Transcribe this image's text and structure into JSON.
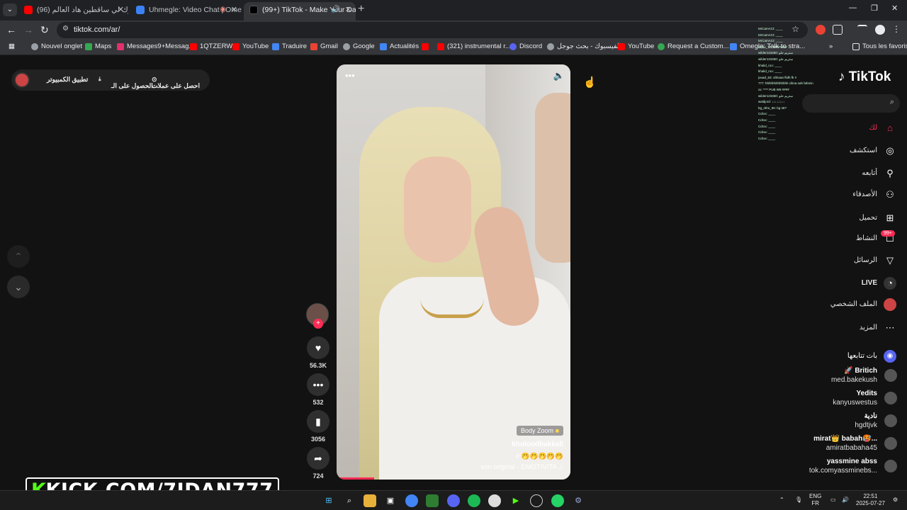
{
  "tabs": [
    {
      "title": "(96) ذوك لي ساقطين هاد العالم",
      "favicon_color": "#ff0000"
    },
    {
      "title": "Uhmegle: Video Chat | Ome",
      "favicon_color": "#3b82f6"
    },
    {
      "title": "(99+) TikTok - Make Your Da",
      "favicon_color": "#000000"
    }
  ],
  "toolbar": {
    "url": "tiktok.com/ar/"
  },
  "bookmarks": [
    {
      "label": "Nouvel onglet",
      "color": "#9aa0a6"
    },
    {
      "label": "Maps",
      "color": "#34a853"
    },
    {
      "label": "Messages9+Messag...",
      "color": "#e1306c"
    },
    {
      "label": "1QTZERW",
      "color": "#ff0000"
    },
    {
      "label": "YouTube",
      "color": "#ff0000"
    },
    {
      "label": "Traduire",
      "color": "#4285f4"
    },
    {
      "label": "Gmail",
      "color": "#ea4335"
    },
    {
      "label": "Google",
      "color": "#9aa0a6"
    },
    {
      "label": "Actualités",
      "color": "#4285f4"
    },
    {
      "label": "(321) instrumental r...",
      "color": "#ff0000"
    },
    {
      "label": "Discord",
      "color": "#5865f2"
    },
    {
      "label": "الفيسبوك - بحث جوجل",
      "color": "#9aa0a6"
    },
    {
      "label": "YouTube",
      "color": "#ff0000"
    },
    {
      "label": "Request a Custom...",
      "color": "#34a853"
    },
    {
      "label": "Omegle: Talk to stra...",
      "color": "#4285f4"
    },
    {
      "label": "Tous les favoris",
      "color": "#9aa0a6"
    }
  ],
  "topbar": {
    "coins": "احصل على عملات",
    "get_app": "الحصول على الـ...",
    "desktop_app": "تطبيق الكمبيوتر"
  },
  "video": {
    "body_zoom": "Body Zoom",
    "author": "kholoodbakkali",
    "caption": "# 🤭🤭🤭🤭🤭",
    "sound": "son original - EMOTIVITA ♫",
    "progress_percent": 16
  },
  "actions": {
    "likes": "56.3K",
    "comments": "532",
    "saves": "3056",
    "shares": "724"
  },
  "brand": {
    "logo": "TikTok",
    "accent": "#fe2c55"
  },
  "nav": [
    {
      "label": "لك",
      "icon": "home-icon",
      "active": true
    },
    {
      "label": "استكشف",
      "icon": "compass-icon"
    },
    {
      "label": "أتابعه",
      "icon": "following-icon"
    },
    {
      "label": "الأصدقاء",
      "icon": "friends-icon"
    },
    {
      "label": "تحميل",
      "icon": "upload-icon"
    },
    {
      "label": "النشاط",
      "icon": "activity-icon"
    },
    {
      "label": "الرسائل",
      "icon": "messages-icon"
    },
    {
      "label": "LIVE",
      "icon": "live-icon"
    },
    {
      "label": "الملف الشخصي",
      "icon": "profile-icon"
    },
    {
      "label": "المزيد",
      "icon": "more-icon"
    }
  ],
  "activity_badge": "99+",
  "following": {
    "title": "بات تتابعها",
    "accounts": [
      {
        "name": "🚀 Britich",
        "handle": "med.bakekush"
      },
      {
        "name": "Yedits",
        "handle": "kanyuswestus"
      },
      {
        "name": "نادية",
        "handle": "hgdtjvk"
      },
      {
        "name": "mirat👑 babah🥵...",
        "handle": "amiratbabaha45"
      },
      {
        "name": "yassmine abss",
        "handle": "tok.comyassminebs..."
      }
    ]
  },
  "chat_lines": [
    "MrCamACt: ____",
    "MrCamACt: ____",
    "MrCamACt: ____",
    "kiddo_77: ########",
    "wilder123450: ستريم حلو",
    "wilder123450: ستريم حلو",
    "khalid_roo: ____",
    "khalid_roo: ____",
    "jouad_63: ohhoan flolh fk !!",
    "777: hhhhhhhhhhhhh clima nah fahmin",
    "xx: **** PUB W9 ####",
    "wilder123450: ستريم حلو",
    "waldjord: ↓↓↓↓↓↓↓↓",
    "bg_ntho_96: bg ntt?",
    "Cdrxx: ____",
    "Cdrxx: ____",
    "Cdrxx: ____",
    "Cdrxx: ____",
    "Cdrxx: ____"
  ],
  "watermark": {
    "prefix": "K",
    "text": "KICK.COM/7IDAN777",
    "accent": "#53fc18"
  },
  "taskbar": {
    "lang_top": "ENG",
    "lang_bottom": "FR",
    "time": "22:51",
    "date": "2025-07-27"
  }
}
